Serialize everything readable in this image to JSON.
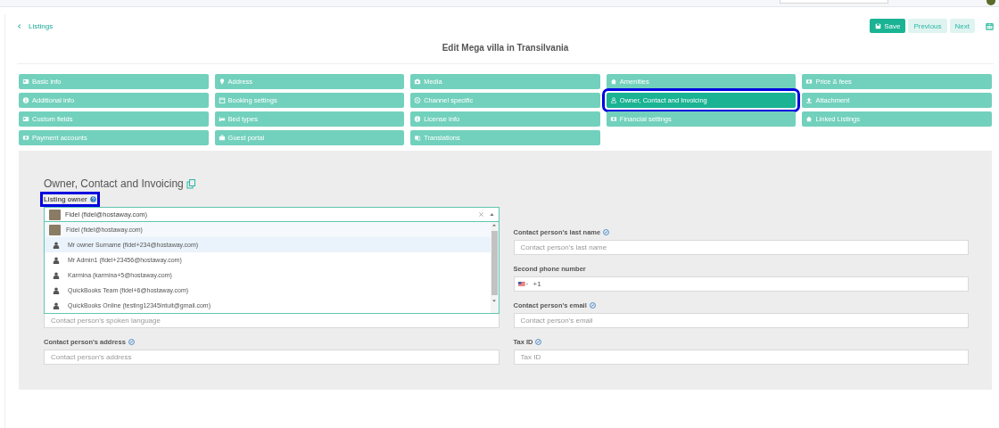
{
  "header": {
    "back_link": "Listings",
    "buttons": [
      {
        "label": "Save",
        "kind": "primary"
      },
      {
        "label": "Previous",
        "kind": "secondary"
      },
      {
        "label": "Next",
        "kind": "secondary"
      }
    ]
  },
  "page_title": "Edit Mega villa in Transilvania",
  "tabs": [
    {
      "label": "Basic info",
      "selected": false,
      "highlighted": false
    },
    {
      "label": "Address",
      "selected": false,
      "highlighted": false
    },
    {
      "label": "Media",
      "selected": false,
      "highlighted": false
    },
    {
      "label": "Amenities",
      "selected": false,
      "highlighted": false
    },
    {
      "label": "Price & fees",
      "selected": false,
      "highlighted": false
    },
    {
      "label": "Additional info",
      "selected": false,
      "highlighted": false
    },
    {
      "label": "Booking settings",
      "selected": false,
      "highlighted": false
    },
    {
      "label": "Channel specific",
      "selected": false,
      "highlighted": false
    },
    {
      "label": "Owner, Contact and Invoicing",
      "selected": true,
      "highlighted": true
    },
    {
      "label": "Attachment",
      "selected": false,
      "highlighted": false
    },
    {
      "label": "Custom fields",
      "selected": false,
      "highlighted": false
    },
    {
      "label": "Bed types",
      "selected": false,
      "highlighted": false
    },
    {
      "label": "License info",
      "selected": false,
      "highlighted": false
    },
    {
      "label": "Financial settings",
      "selected": false,
      "highlighted": false
    },
    {
      "label": "Linked Listings",
      "selected": false,
      "highlighted": false
    },
    {
      "label": "Payment accounts",
      "selected": false,
      "highlighted": false
    },
    {
      "label": "Guest portal",
      "selected": false,
      "highlighted": false
    },
    {
      "label": "Translations",
      "selected": false,
      "highlighted": false
    }
  ],
  "section": {
    "title": "Owner, Contact and Invoicing",
    "owner_select": {
      "label": "Listing owner",
      "highlighted": true,
      "value": "Fidel (fidel@hostaway.com)",
      "expanded": true,
      "options": [
        {
          "label": "Fidel (fidel@hostaway.com)",
          "kind": "photo",
          "selected": true,
          "hovered": false
        },
        {
          "label": "Mr owner Surname (fidel+234@hostaway.com)",
          "kind": "person",
          "selected": false,
          "hovered": true
        },
        {
          "label": "Mr Admin1 (fidel+23456@hostaway.com)",
          "kind": "person",
          "selected": false,
          "hovered": false
        },
        {
          "label": "Karmina (karmina+5@hostaway.com)",
          "kind": "person",
          "selected": false,
          "hovered": false
        },
        {
          "label": "QuickBooks Team (fidel+6@hostaway.com)",
          "kind": "person",
          "selected": false,
          "hovered": false
        },
        {
          "label": "QuickBooks Online (testing12345intuit@gmail.com)",
          "kind": "person",
          "selected": false,
          "hovered": false
        }
      ]
    },
    "left_fields": [
      {
        "kind": "text",
        "placeholder": "Contact person's spoken language"
      },
      {
        "kind": "text",
        "label": "Contact person's address",
        "info_icon": true,
        "placeholder": "Contact person's address"
      }
    ],
    "right_fields": [
      {
        "kind": "text",
        "label": "Contact person's last name",
        "info_icon": true,
        "placeholder": "Contact person's last name"
      },
      {
        "kind": "phone",
        "label": "Second phone number",
        "info_icon": false,
        "value": "+1"
      },
      {
        "kind": "text",
        "label": "Contact person's email",
        "info_icon": true,
        "placeholder": "Contact person's email"
      },
      {
        "kind": "text",
        "label": "Tax ID",
        "info_icon": true,
        "placeholder": "Tax ID"
      }
    ]
  }
}
